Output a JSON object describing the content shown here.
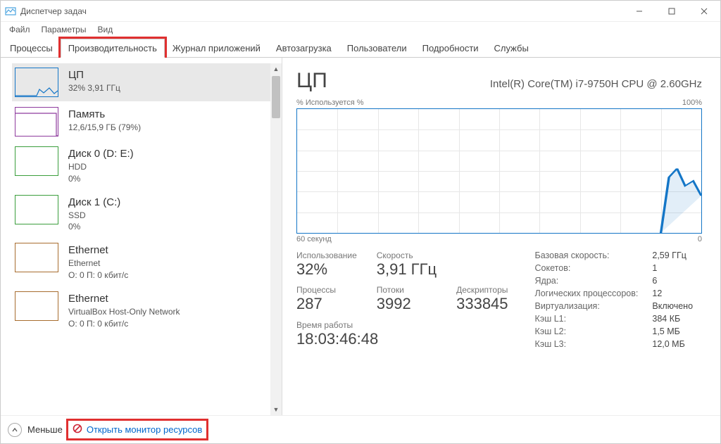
{
  "window": {
    "title": "Диспетчер задач"
  },
  "menu": {
    "file": "Файл",
    "params": "Параметры",
    "view": "Вид"
  },
  "tabs": {
    "processes": "Процессы",
    "performance": "Производительность",
    "app_history": "Журнал приложений",
    "startup": "Автозагрузка",
    "users": "Пользователи",
    "details": "Подробности",
    "services": "Службы"
  },
  "sidebar": {
    "items": [
      {
        "title": "ЦП",
        "sub": "32% 3,91 ГГц",
        "kind": "cpu",
        "selected": true
      },
      {
        "title": "Память",
        "sub": "12,6/15,9 ГБ (79%)",
        "kind": "mem"
      },
      {
        "title": "Диск 0 (D: E:)",
        "sub": "HDD",
        "sub2": "0%",
        "kind": "disk"
      },
      {
        "title": "Диск 1 (C:)",
        "sub": "SSD",
        "sub2": "0%",
        "kind": "disk"
      },
      {
        "title": "Ethernet",
        "sub": "Ethernet",
        "sub2": "О: 0 П: 0 кбит/с",
        "kind": "net"
      },
      {
        "title": "Ethernet",
        "sub": "VirtualBox Host-Only Network",
        "sub2": "О: 0 П: 0 кбит/с",
        "kind": "net"
      }
    ]
  },
  "footer": {
    "less": "Меньше",
    "open_resmon": "Открыть монитор ресурсов"
  },
  "detail": {
    "heading": "ЦП",
    "cpu_name": "Intel(R) Core(TM) i7-9750H CPU @ 2.60GHz",
    "graph_top_left": "% Используется %",
    "graph_top_right": "100%",
    "graph_bottom_left": "60 секунд",
    "graph_bottom_right": "0",
    "stats_left": [
      {
        "label": "Использование",
        "value": "32%"
      },
      {
        "label": "Скорость",
        "value": "3,91 ГГц"
      },
      {
        "label": "Процессы",
        "value": "287"
      },
      {
        "label": "Потоки",
        "value": "3992"
      },
      {
        "label": "Дескрипторы",
        "value": "333845"
      },
      {
        "label": "Время работы",
        "value": "18:03:46:48"
      }
    ],
    "stats_right": [
      {
        "k": "Базовая скорость:",
        "v": "2,59 ГГц"
      },
      {
        "k": "Сокетов:",
        "v": "1"
      },
      {
        "k": "Ядра:",
        "v": "6"
      },
      {
        "k": "Логических процессоров:",
        "v": "12"
      },
      {
        "k": "Виртуализация:",
        "v": "Включено"
      },
      {
        "k": "Кэш L1:",
        "v": "384 КБ"
      },
      {
        "k": "Кэш L2:",
        "v": "1,5 МБ"
      },
      {
        "k": "Кэш L3:",
        "v": "12,0 МБ"
      }
    ]
  }
}
